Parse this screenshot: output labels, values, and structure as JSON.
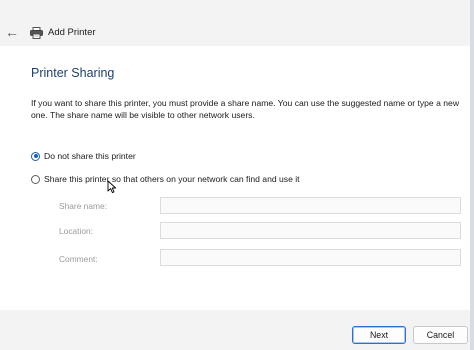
{
  "window": {
    "title": "Add Printer",
    "back_icon": "←"
  },
  "page": {
    "heading": "Printer Sharing",
    "description": "If you want to share this printer, you must provide a share name. You can use the suggested name or type a new one. The share name will be visible to other network users."
  },
  "options": {
    "do_not_share": {
      "label": "Do not share this printer",
      "selected": true
    },
    "share": {
      "label": "Share this printer so that others on your network can find and use it",
      "selected": false
    }
  },
  "fields": {
    "share_name": {
      "label": "Share name:",
      "value": ""
    },
    "location": {
      "label": "Location:",
      "value": ""
    },
    "comment": {
      "label": "Comment:",
      "value": ""
    }
  },
  "buttons": {
    "next": "Next",
    "cancel": "Cancel"
  },
  "colors": {
    "heading": "#1e3f6e",
    "accent": "#1a5fb4",
    "window_bg": "#f3f3f3",
    "content_bg": "#ffffff"
  },
  "icons": {
    "back": "arrow-left-icon",
    "printer": "printer-icon",
    "cursor": "mouse-pointer-icon"
  }
}
